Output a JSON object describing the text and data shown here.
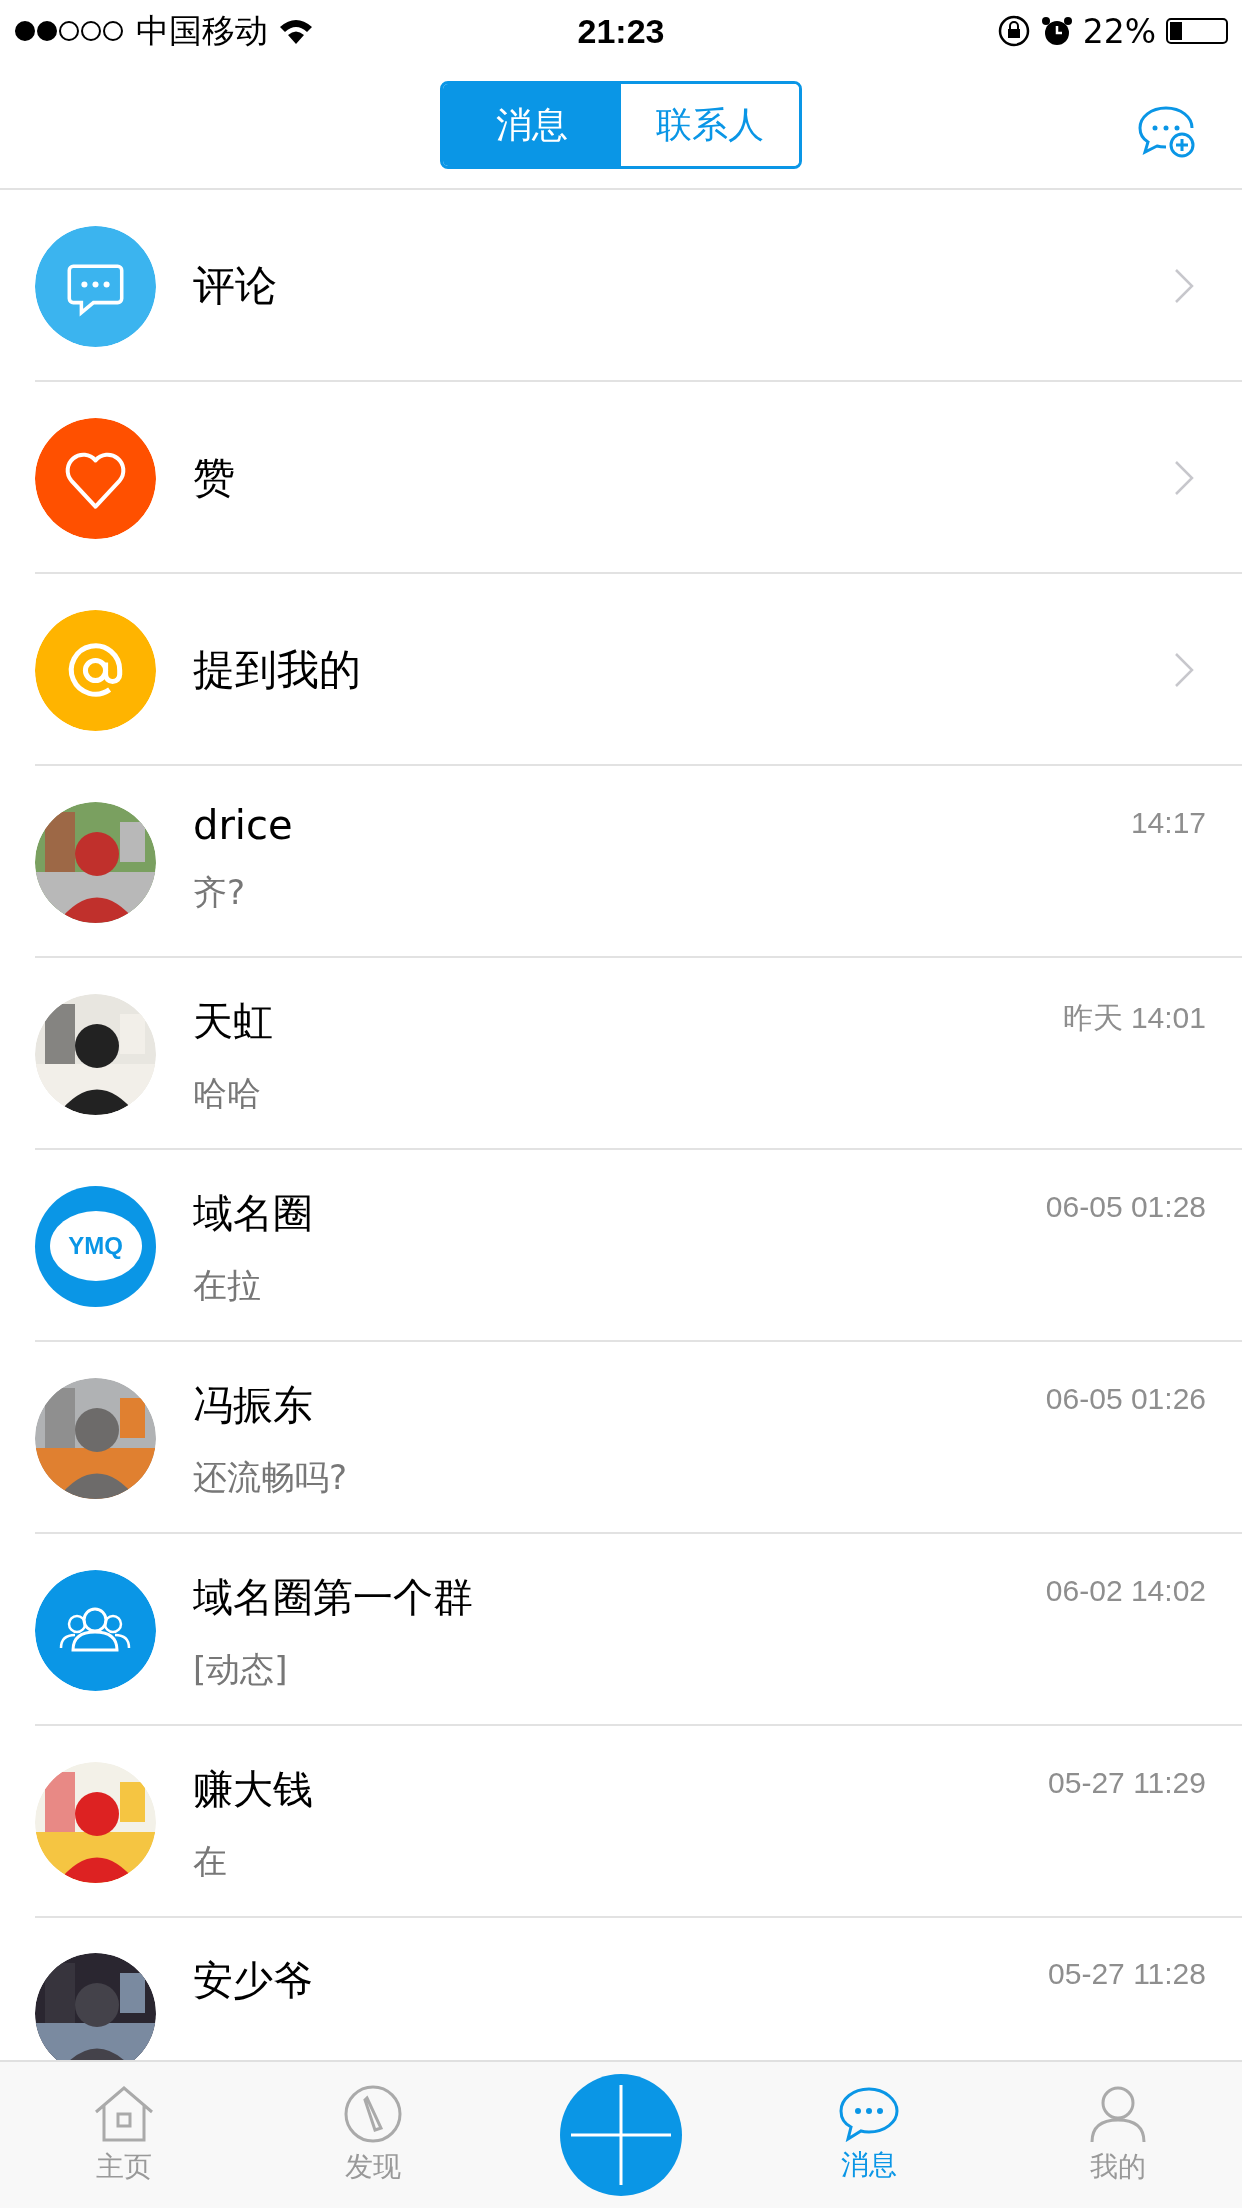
{
  "status_bar": {
    "carrier": "中国移动",
    "time": "21:23",
    "battery": "22%"
  },
  "header": {
    "tabs": [
      {
        "label": "消息",
        "selected": true
      },
      {
        "label": "联系人",
        "selected": false
      }
    ]
  },
  "shortcuts": [
    {
      "kind": "comment",
      "label": "评论",
      "color": "#3bb4ef"
    },
    {
      "kind": "like",
      "label": "赞",
      "color": "#ff5000"
    },
    {
      "kind": "mention",
      "label": "提到我的",
      "color": "#ffb400"
    }
  ],
  "chats": [
    {
      "kind": "picture",
      "name": "drice",
      "time": "14:17",
      "preview": "齐?"
    },
    {
      "kind": "picture",
      "name": "天虹",
      "time": "昨天 14:01",
      "preview": "哈哈"
    },
    {
      "kind": "logo",
      "logo_text": "YMQ",
      "name": "域名圈",
      "time": "06-05 01:28",
      "preview": "在拉"
    },
    {
      "kind": "picture",
      "name": "冯振东",
      "time": "06-05 01:26",
      "preview": "还流畅吗?"
    },
    {
      "kind": "group",
      "name": "域名圈第一个群",
      "time": "06-02 14:02",
      "preview": "[动态]"
    },
    {
      "kind": "picture",
      "name": "赚大钱",
      "time": "05-27 11:29",
      "preview": "在"
    },
    {
      "kind": "picture",
      "name": "安少爷",
      "time": "05-27 11:28"
    }
  ],
  "tab_bar": [
    {
      "kind": "home",
      "label": "主页",
      "selected": false
    },
    {
      "kind": "discover",
      "label": "发现",
      "selected": false
    },
    {
      "kind": "add",
      "selected": false
    },
    {
      "kind": "messages",
      "label": "消息",
      "selected": true
    },
    {
      "kind": "profile",
      "label": "我的",
      "selected": false
    }
  ]
}
